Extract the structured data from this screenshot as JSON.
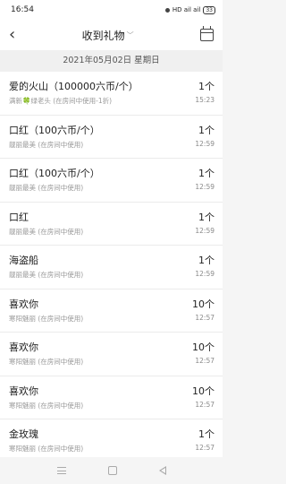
{
  "status_bar": {
    "time": "16:54",
    "indicators": "HD ail ail",
    "battery": "33"
  },
  "nav": {
    "title": "收到礼物",
    "title_chevron": "﹀",
    "back_glyph": "‹"
  },
  "date_header": "2021年05月02日 星期日",
  "items": [
    {
      "name": "爱的火山（100000六币/个）",
      "sub": "满新🍀绿老头 (在房间中使用-1折)",
      "qty": "1个",
      "time": "15:23"
    },
    {
      "name": "口红（100六币/个）",
      "sub": "靓丽最美 (在房间中使用)",
      "qty": "1个",
      "time": "12:59"
    },
    {
      "name": "口红（100六币/个）",
      "sub": "靓丽最美 (在房间中使用)",
      "qty": "1个",
      "time": "12:59"
    },
    {
      "name": "口红",
      "sub": "靓丽最美 (在房间中使用)",
      "qty": "1个",
      "time": "12:59"
    },
    {
      "name": "海盗船",
      "sub": "靓丽最美 (在房间中使用)",
      "qty": "1个",
      "time": "12:59"
    },
    {
      "name": "喜欢你",
      "sub": "寒阳魅丽 (在房间中使用)",
      "qty": "10个",
      "time": "12:57"
    },
    {
      "name": "喜欢你",
      "sub": "寒阳魅丽 (在房间中使用)",
      "qty": "10个",
      "time": "12:57"
    },
    {
      "name": "喜欢你",
      "sub": "寒阳魅丽 (在房间中使用)",
      "qty": "10个",
      "time": "12:57"
    },
    {
      "name": "金玫瑰",
      "sub": "寒阳魅丽 (在房间中使用)",
      "qty": "1个",
      "time": "12:57"
    }
  ],
  "icons": {
    "back": "back-arrow-icon",
    "calendar": "calendar-icon",
    "menu": "menu-icon",
    "home": "home-icon",
    "nav_back": "nav-back-icon"
  }
}
